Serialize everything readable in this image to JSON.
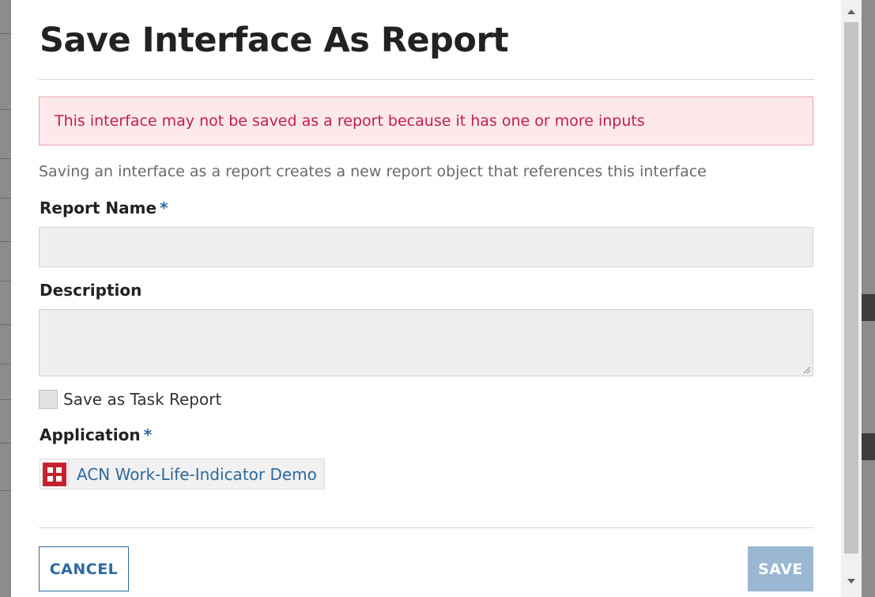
{
  "modal": {
    "title": "Save Interface As Report",
    "alert": "This interface may not be saved as a report because it has one or more inputs",
    "help_text": "Saving an interface as a report creates a new report object that references this interface",
    "report_name": {
      "label": "Report Name",
      "required_mark": "*",
      "value": ""
    },
    "description": {
      "label": "Description",
      "value": ""
    },
    "task_report": {
      "label": "Save as Task Report",
      "checked": false
    },
    "application": {
      "label": "Application",
      "required_mark": "*",
      "value": "ACN Work-Life-Indicator Demo",
      "icon": "application-icon"
    },
    "buttons": {
      "cancel": "CANCEL",
      "save": "SAVE"
    }
  },
  "colors": {
    "accent": "#2c6aa0",
    "alert_text": "#c61d48",
    "alert_bg": "#fde9ec",
    "save_disabled": "#9ab7d4",
    "app_icon": "#c8202f"
  }
}
